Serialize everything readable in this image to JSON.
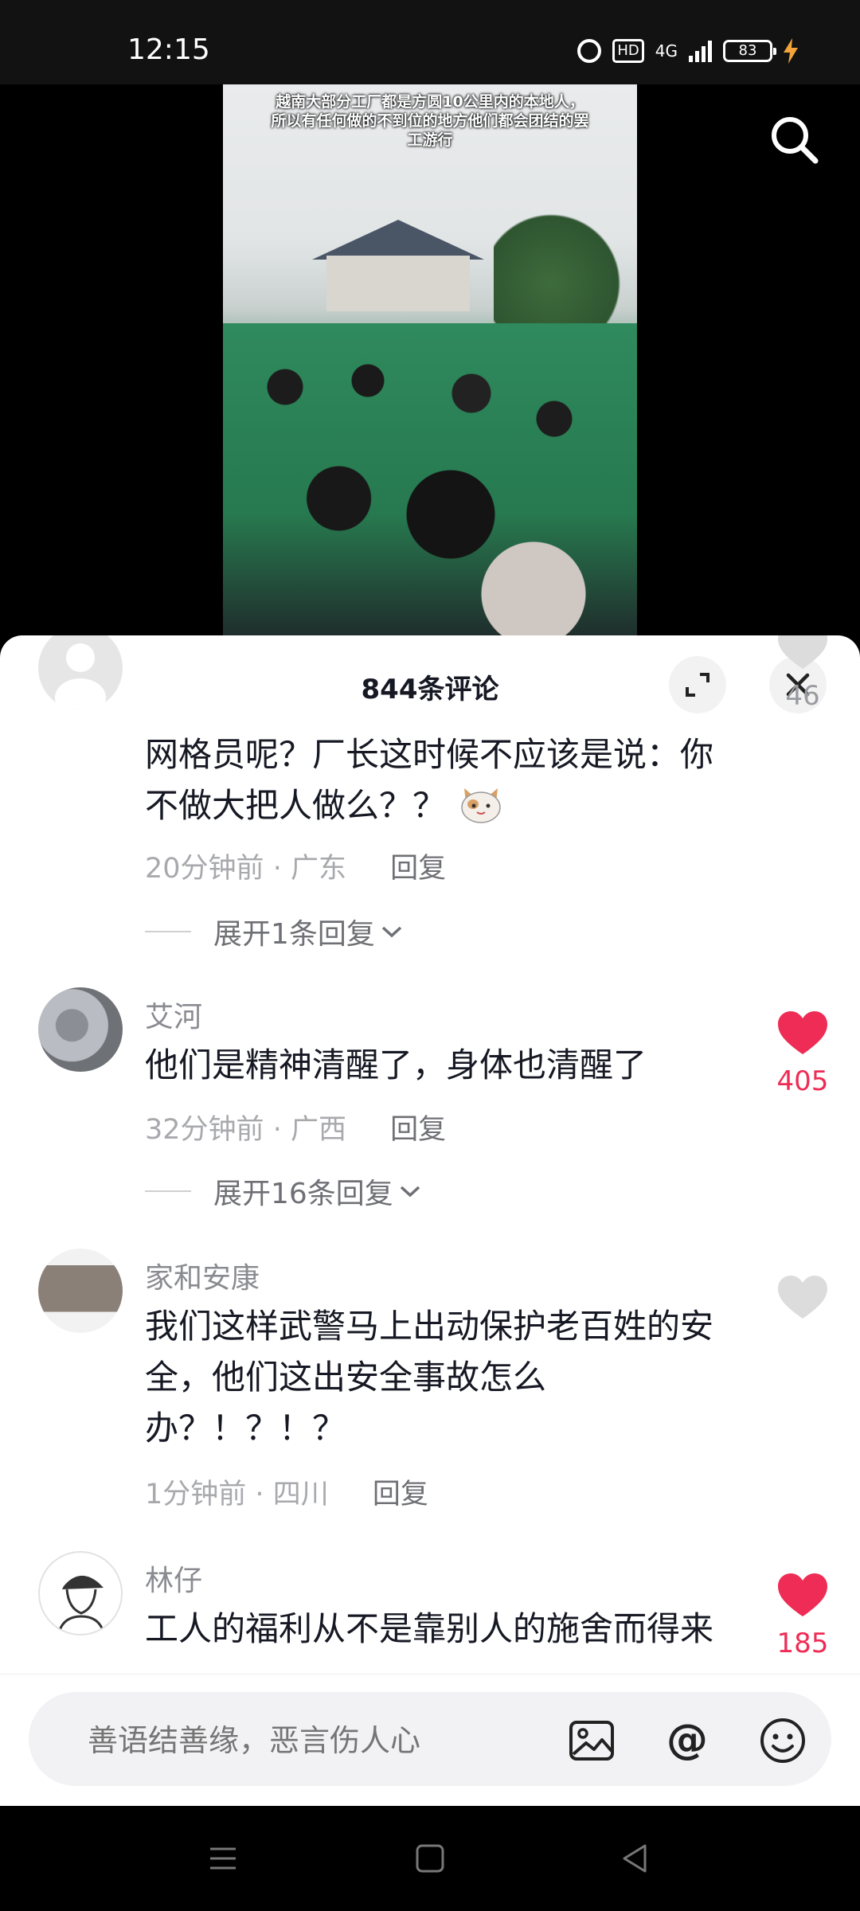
{
  "status_bar": {
    "time": "12:15",
    "hd_label": "HD",
    "network_label": "4G",
    "battery": "83",
    "icons": [
      "alarm-icon",
      "hd-icon",
      "signal-icon",
      "battery-icon",
      "charging-icon"
    ]
  },
  "video": {
    "caption": "越南大部分工厂都是方圆10公里内的本地人，所以有任何做的不到位的地方他们都会团结的罢工游行"
  },
  "comments_header": {
    "title": "844条评论"
  },
  "comments": [
    {
      "username": "",
      "text": "网格员呢？厂长这时候不应该是说：你不做大把人做么？？",
      "emoji": "cat-emoji",
      "time": "20分钟前",
      "location": "广东",
      "reply_label": "回复",
      "expand_label": "展开1条回复",
      "likes": "46",
      "liked": false
    },
    {
      "username": "艾河",
      "text": "他们是精神清醒了，身体也清醒了",
      "time": "32分钟前",
      "location": "广西",
      "reply_label": "回复",
      "expand_label": "展开16条回复",
      "likes": "405",
      "liked": true
    },
    {
      "username": "家和安康",
      "text": "我们这样武警马上出动保护老百姓的安全，他们这出安全事故怎么办？！？！？",
      "time": "1分钟前",
      "location": "四川",
      "reply_label": "回复",
      "likes": "",
      "liked": false
    },
    {
      "username": "林仔",
      "text": "工人的福利从不是靠别人的施舍而得来",
      "likes": "185",
      "liked": true
    }
  ],
  "input": {
    "placeholder": "善语结善缘，恶言伤人心"
  },
  "colors": {
    "like_red": "#ee2c55",
    "text_dark": "#161823",
    "text_gray": "#a8a9ad"
  }
}
